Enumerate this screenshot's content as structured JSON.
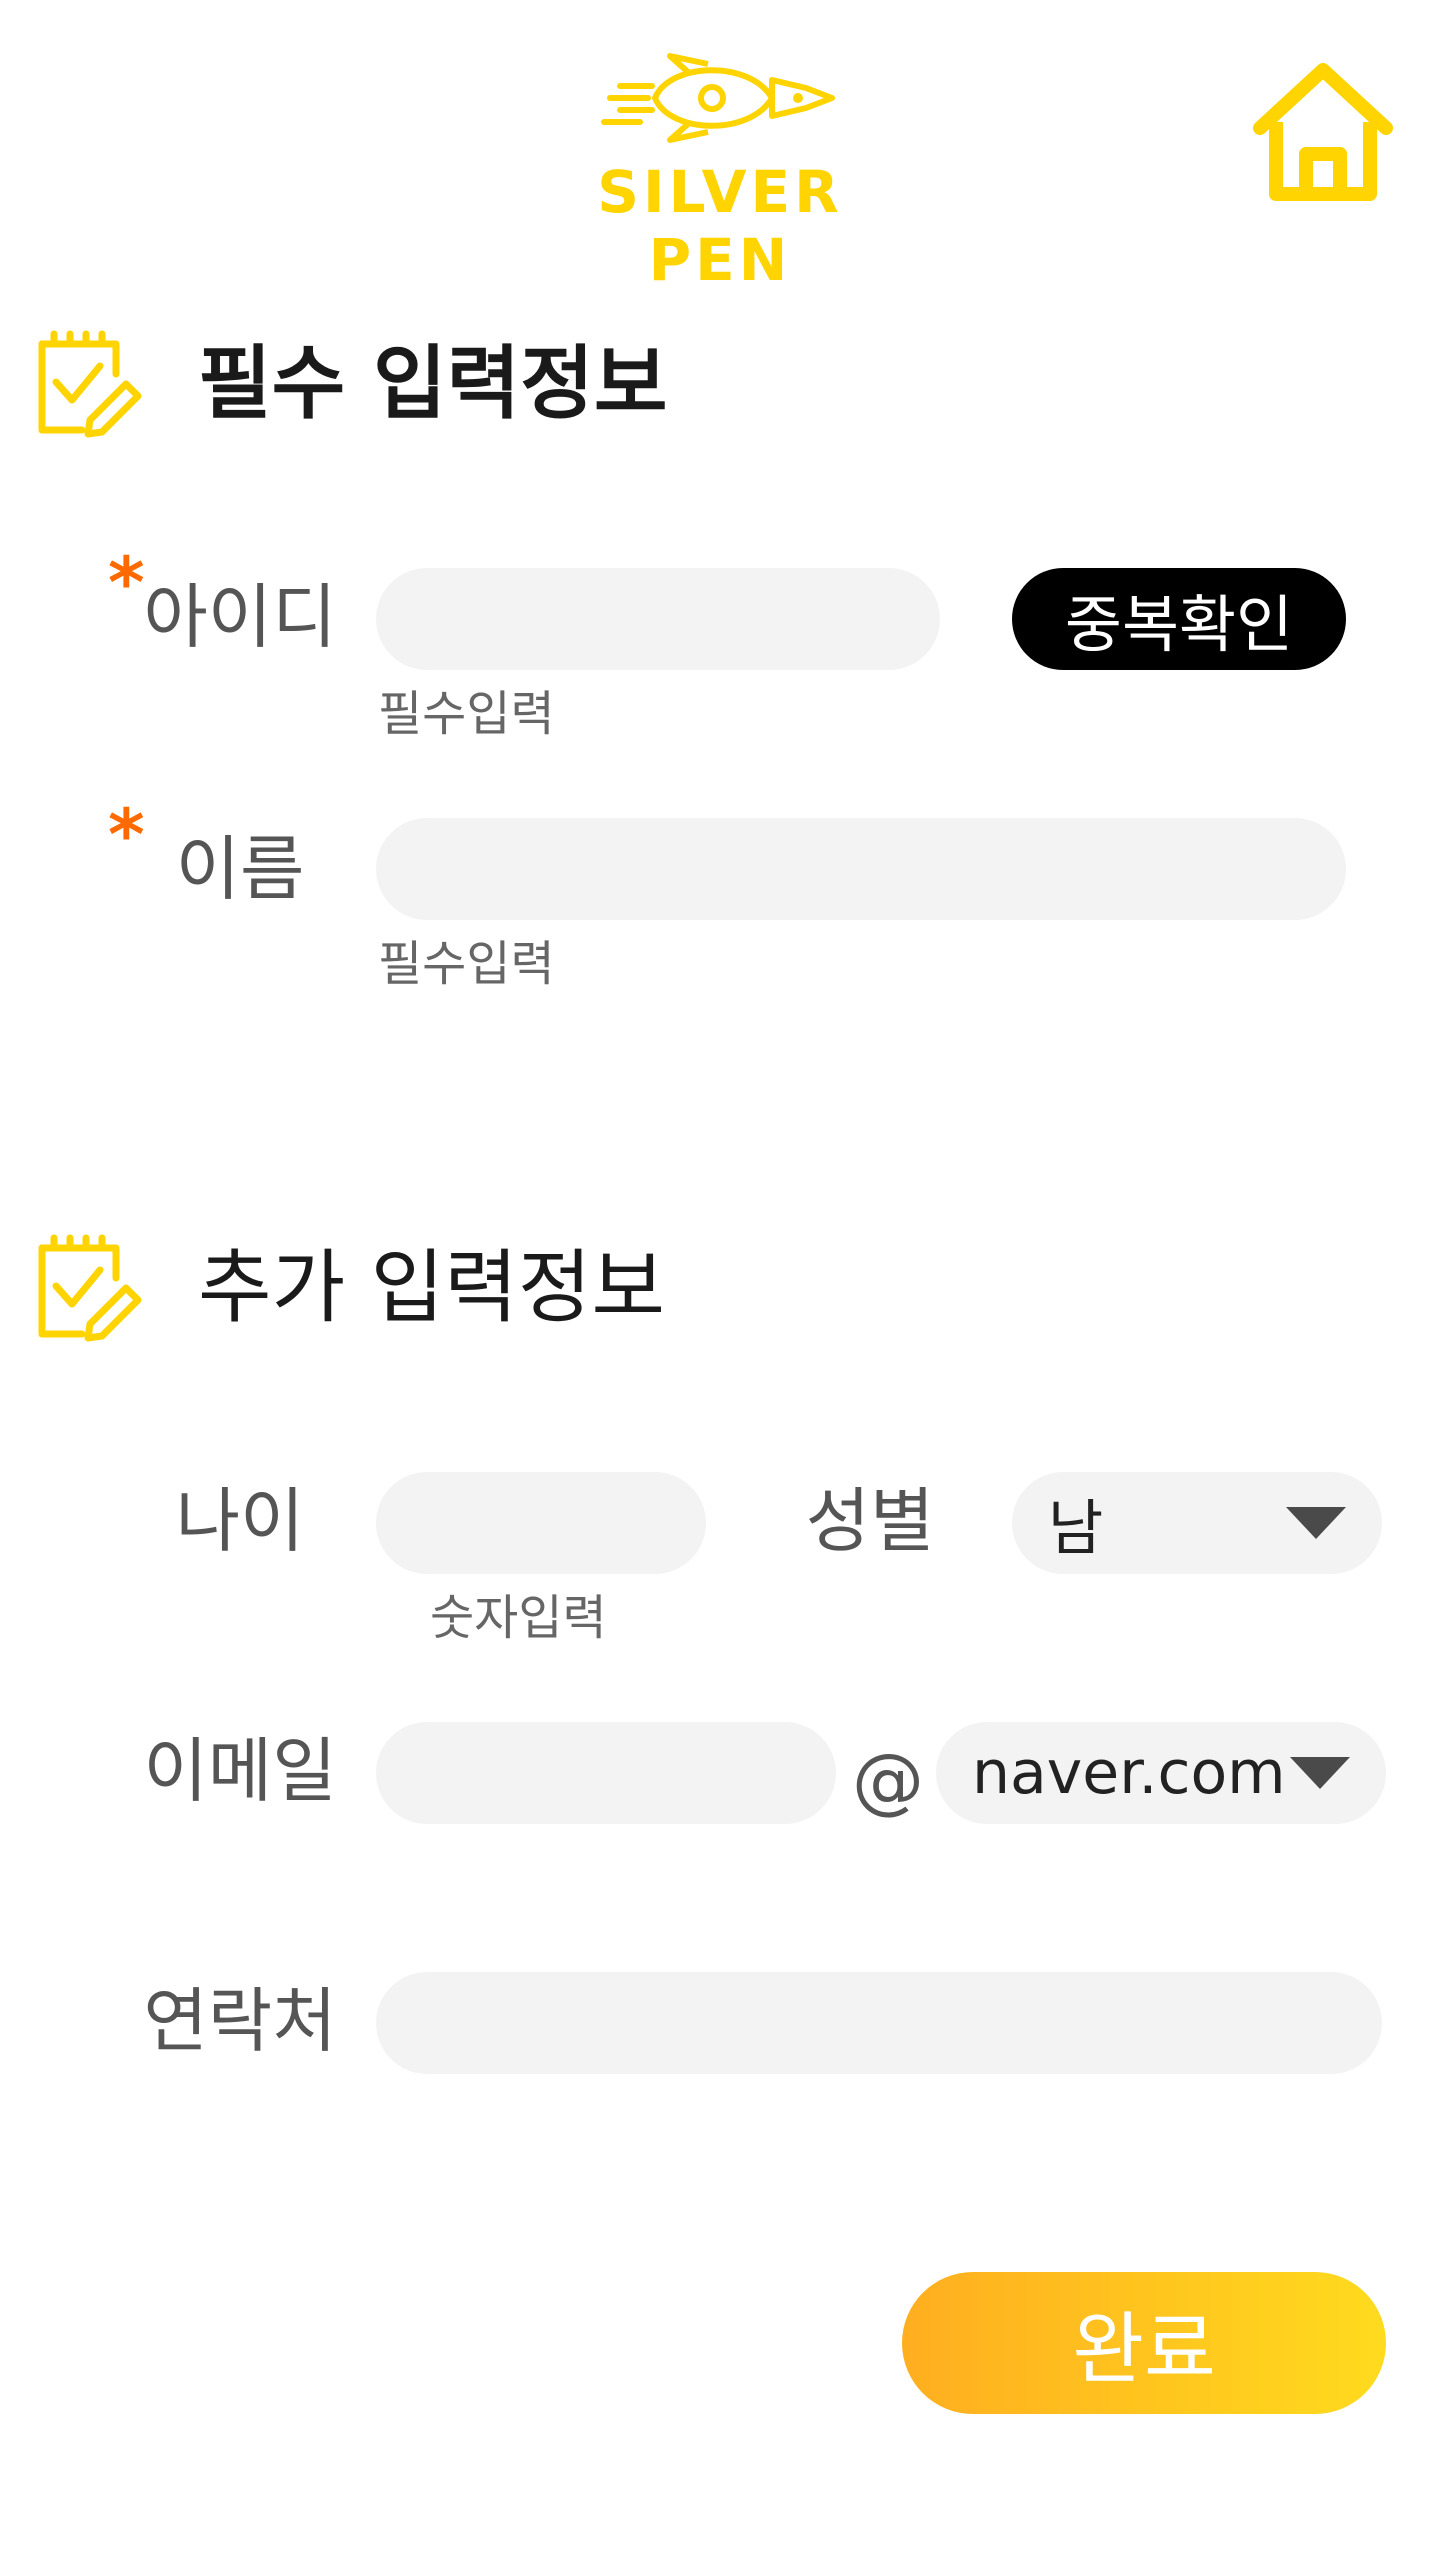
{
  "header": {
    "logo_text": "SILVER PEN",
    "icons": {
      "logo": "rocket-pen-icon",
      "home": "home-icon"
    }
  },
  "colors": {
    "accent_yellow": "#FFD400",
    "required_mark": "#FF6A00",
    "field_bg": "#F3F3F3",
    "button_dark": "#000000",
    "gradient_start": "#FFAE1F",
    "gradient_end": "#FFDB1E"
  },
  "required_section": {
    "title": "필수 입력정보",
    "icon": "notepad-check-pencil-icon",
    "id": {
      "asterisk": "*",
      "label": "아이디",
      "value": "",
      "hint": "필수입력",
      "check_button": "중복확인"
    },
    "name": {
      "asterisk": "*",
      "label": "이름",
      "value": "",
      "hint": "필수입력"
    }
  },
  "additional_section": {
    "title": "추가 입력정보",
    "icon": "notepad-check-pencil-icon",
    "age": {
      "label": "나이",
      "value": "",
      "hint": "숫자입력"
    },
    "gender": {
      "label": "성별",
      "selected": "남"
    },
    "email": {
      "label": "이메일",
      "value": "",
      "at": "@",
      "domain_selected": "naver.com"
    },
    "contact": {
      "label": "연락처",
      "value": ""
    }
  },
  "actions": {
    "done_label": "완료"
  }
}
